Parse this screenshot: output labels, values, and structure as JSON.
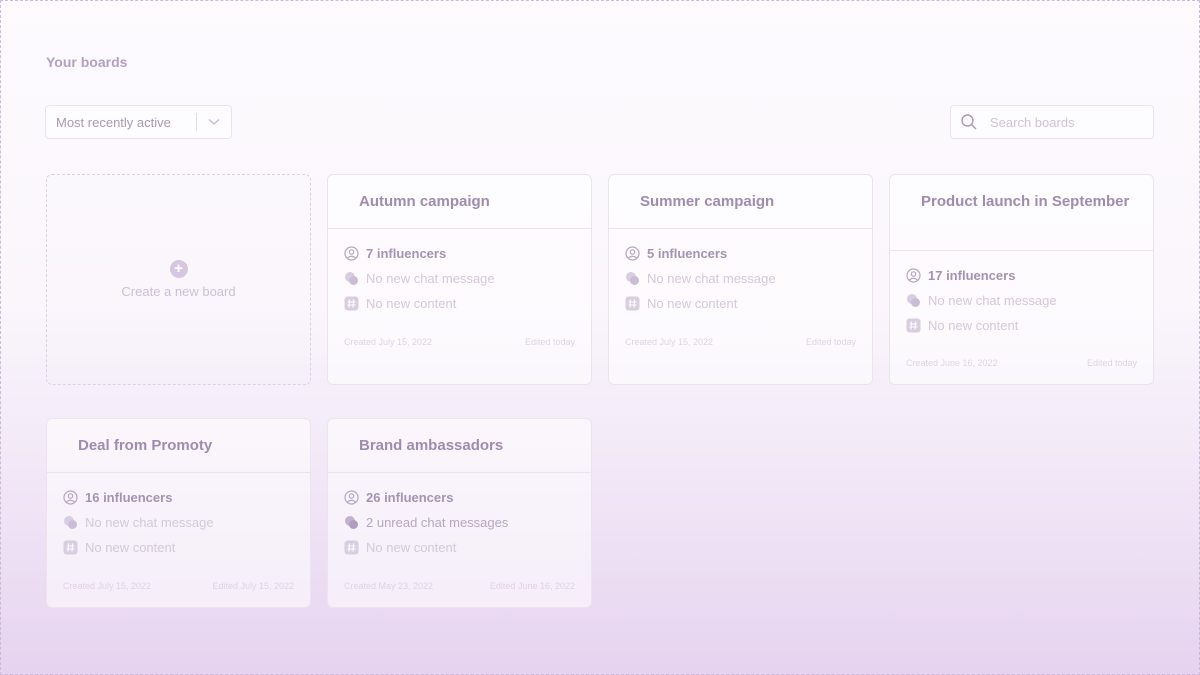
{
  "page": {
    "title": "Your boards"
  },
  "sort": {
    "label": "Most recently active"
  },
  "search": {
    "placeholder": "Search boards"
  },
  "create": {
    "label": "Create a new board"
  },
  "boards": [
    {
      "title": "Autumn campaign",
      "influencers": "7 influencers",
      "chat": "No new chat message",
      "content": "No new content",
      "created": "Created July 15, 2022",
      "edited": "Edited today"
    },
    {
      "title": "Summer campaign",
      "influencers": "5 influencers",
      "chat": "No new chat message",
      "content": "No new content",
      "created": "Created July 15, 2022",
      "edited": "Edited today"
    },
    {
      "title": "Product launch in September",
      "influencers": "17 influencers",
      "chat": "No new chat message",
      "content": "No new content",
      "created": "Created June 16, 2022",
      "edited": "Edited today"
    },
    {
      "title": "Deal from Promoty",
      "influencers": "16 influencers",
      "chat": "No new chat message",
      "content": "No new content",
      "created": "Created July 15, 2022",
      "edited": "Edited July 15, 2022"
    },
    {
      "title": "Brand ambassadors",
      "influencers": "26 influencers",
      "chat": "2 unread chat messages",
      "content": "No new content",
      "created": "Created May 23, 2022",
      "edited": "Edited June 16, 2022"
    }
  ],
  "colors": {
    "accent": "#a08cb0",
    "muted": "#d4c8dc",
    "border": "#ece3f1"
  }
}
